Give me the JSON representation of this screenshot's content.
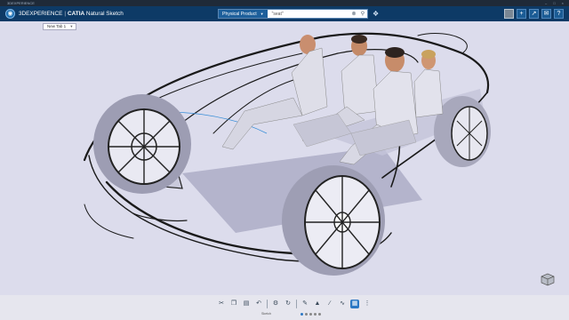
{
  "window": {
    "title": "3DEXPERIENCE"
  },
  "header": {
    "brand_prefix": "3DEXPERIENCE",
    "app_name": "CATIA",
    "app_module": "Natural Sketch"
  },
  "search": {
    "scope": "Physical Product",
    "query": "\"seat\""
  },
  "tabs": [
    {
      "label": "New Tab 1"
    }
  ],
  "action_bar": {
    "section": "Sketch"
  },
  "colors": {
    "topbar": "#0d3a66",
    "viewport_bg": "#dcdcec",
    "accent": "#2b77c4"
  }
}
